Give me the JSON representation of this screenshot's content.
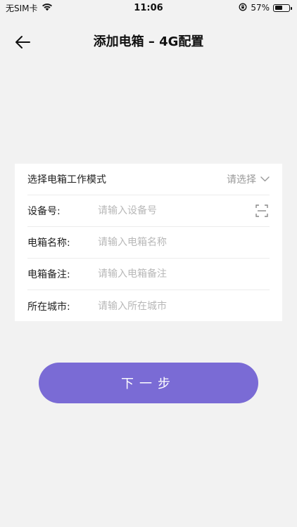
{
  "status_bar": {
    "carrier": "无SIM卡",
    "time": "11:06",
    "battery_percent": "57%",
    "battery_level": 0.57
  },
  "nav": {
    "title": "添加电箱 – 4G配置"
  },
  "form": {
    "mode_row": {
      "label": "选择电箱工作模式",
      "select_placeholder": "请选择"
    },
    "device_row": {
      "label": "设备号:",
      "placeholder": "请输入设备号"
    },
    "name_row": {
      "label": "电箱名称:",
      "placeholder": "请输入电箱名称"
    },
    "note_row": {
      "label": "电箱备注:",
      "placeholder": "请输入电箱备注"
    },
    "city_row": {
      "label": "所在城市:",
      "placeholder": "请输入所在城市"
    }
  },
  "next_button": {
    "label": "下一步"
  },
  "colors": {
    "accent": "#7a6bd5",
    "background": "#f2f2f2"
  }
}
